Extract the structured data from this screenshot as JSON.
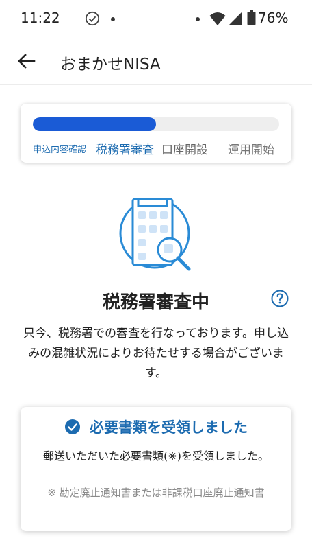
{
  "status_bar": {
    "time": "11:22",
    "battery_percent": "76%"
  },
  "app_bar": {
    "back_icon": "arrow-left-icon",
    "title": "おまかせNISA"
  },
  "progress": {
    "fraction": 0.5,
    "fill_color": "#1a5bd6",
    "steps": [
      {
        "label": "申込内容確認",
        "state": "done"
      },
      {
        "label": "税務署審査",
        "state": "current"
      },
      {
        "label": "口座開設",
        "state": "pending"
      },
      {
        "label": "運用開始",
        "state": "pending"
      }
    ]
  },
  "illustration": {
    "icon": "building-search-icon"
  },
  "status": {
    "heading": "税務署審査中",
    "help_icon": "question-circle-icon",
    "description": "只今、税務署での審査を行なっております。申し込みの混雑状況によりお待たせする場合がございます。"
  },
  "received_card": {
    "icon": "check-circle-icon",
    "title": "必要書類を受領しました",
    "body": "郵送いただいた必要書類(※)を受領しました。",
    "note": "※ 勘定廃止通知書または非課税口座廃止通知書",
    "accent_color": "#1c6bb0"
  }
}
